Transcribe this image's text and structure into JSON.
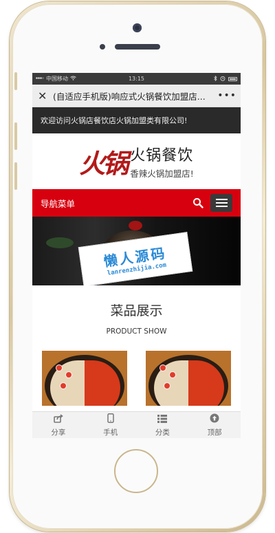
{
  "status_bar": {
    "carrier": "中国移动",
    "time": "13:15",
    "battery": "🔋"
  },
  "title_bar": {
    "close": "✕",
    "title": "(自适应手机版)响应式火锅餐饮加盟店...",
    "more": "•••"
  },
  "header": {
    "welcome": "欢迎访问火锅店餐饮店火锅加盟类有限公司!"
  },
  "logo": {
    "mark": "火锅",
    "main": "火锅餐饮",
    "sub": "香辣火锅加盟店!"
  },
  "nav": {
    "label": "导航菜单"
  },
  "banner": {
    "watermark_cn": "懒人源码",
    "watermark_en": "lanrenzhijia.com"
  },
  "section": {
    "title": "菜品展示",
    "subtitle": "PRODUCT SHOW"
  },
  "tabbar": [
    {
      "label": "分享",
      "icon": "share-icon"
    },
    {
      "label": "手机",
      "icon": "phone-icon"
    },
    {
      "label": "分类",
      "icon": "grid-list-icon"
    },
    {
      "label": "顶部",
      "icon": "arrow-up-circle-icon"
    }
  ],
  "colors": {
    "nav_red": "#d7000f",
    "header_dark": "#2a2a2a",
    "watermark_blue": "#2a8ad6"
  }
}
